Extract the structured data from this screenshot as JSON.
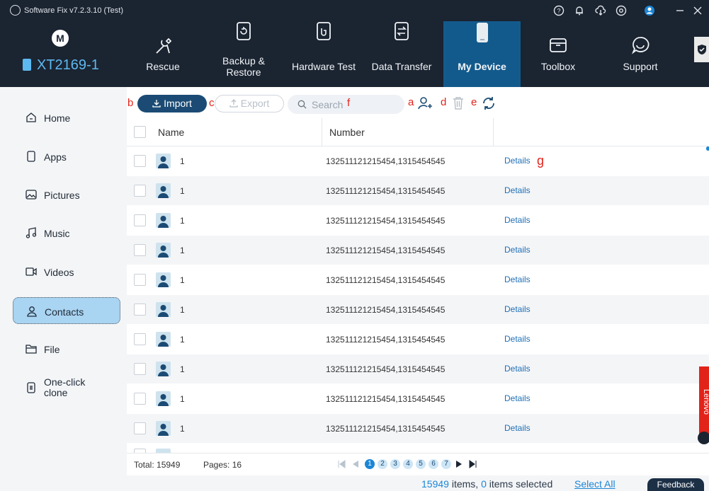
{
  "titlebar": {
    "title": "Software Fix v7.2.3.10 (Test)"
  },
  "header": {
    "brand_glyph": "M",
    "device_name": "XT2169-1",
    "tabs": [
      {
        "label": "Rescue",
        "icon": "tools-icon"
      },
      {
        "label": "Backup & Restore",
        "icon": "backup-restore-icon"
      },
      {
        "label": "Hardware Test",
        "icon": "hardware-test-icon"
      },
      {
        "label": "Data Transfer",
        "icon": "data-transfer-icon"
      },
      {
        "label": "My Device",
        "icon": "phone-device-icon",
        "active": true
      },
      {
        "label": "Toolbox",
        "icon": "toolbox-icon"
      },
      {
        "label": "Support",
        "icon": "support-chat-icon"
      }
    ]
  },
  "sidebar": {
    "items": [
      {
        "label": "Home",
        "icon": "home-icon"
      },
      {
        "label": "Apps",
        "icon": "phone-icon"
      },
      {
        "label": "Pictures",
        "icon": "picture-icon"
      },
      {
        "label": "Music",
        "icon": "music-icon"
      },
      {
        "label": "Videos",
        "icon": "video-icon"
      },
      {
        "label": "Contacts",
        "icon": "contact-icon",
        "active": true
      },
      {
        "label": "File",
        "icon": "folder-icon"
      },
      {
        "label": "One-click clone",
        "icon": "clone-icon"
      }
    ]
  },
  "toolbar": {
    "import_label": "Import",
    "export_label": "Export",
    "search_placeholder": "Search",
    "annotations": {
      "a": "a",
      "b": "b",
      "c": "c",
      "d": "d",
      "e": "e",
      "f": "f",
      "g": "g"
    }
  },
  "table": {
    "columns": {
      "name": "Name",
      "number": "Number"
    },
    "rows": [
      {
        "name": "1",
        "number": "1325111212154541315454545",
        "number_display": "132511121215454,1315454545",
        "action": "Details"
      },
      {
        "name": "1",
        "number_display": "132511121215454,1315454545",
        "action": "Details"
      },
      {
        "name": "1",
        "number_display": "132511121215454,1315454545",
        "action": "Details"
      },
      {
        "name": "1",
        "number_display": "132511121215454,1315454545",
        "action": "Details"
      },
      {
        "name": "1",
        "number_display": "132511121215454,1315454545",
        "action": "Details"
      },
      {
        "name": "1",
        "number_display": "132511121215454,1315454545",
        "action": "Details"
      },
      {
        "name": "1",
        "number_display": "132511121215454,1315454545",
        "action": "Details"
      },
      {
        "name": "1",
        "number_display": "132511121215454,1315454545",
        "action": "Details"
      },
      {
        "name": "1",
        "number_display": "132511121215454,1315454545",
        "action": "Details"
      },
      {
        "name": "1",
        "number_display": "132511121215454,1315454545",
        "action": "Details"
      }
    ]
  },
  "pager": {
    "total": "Total: 15949",
    "pages": "Pages: 16",
    "page_numbers": [
      "1",
      "2",
      "3",
      "4",
      "5",
      "6",
      "7"
    ],
    "current": "1"
  },
  "status": {
    "count": "15949",
    "items_text": "items,",
    "selected": "0",
    "selected_text": "items selected",
    "select_all": "Select All"
  },
  "feedback_label": "Feedback",
  "lenovo_label": "Lenovo",
  "colors": {
    "header_bg": "#1b2431",
    "active_tab": "#135a8c",
    "accent": "#1c86d6",
    "annotation": "#e2231a",
    "link": "#1f6fb5"
  }
}
